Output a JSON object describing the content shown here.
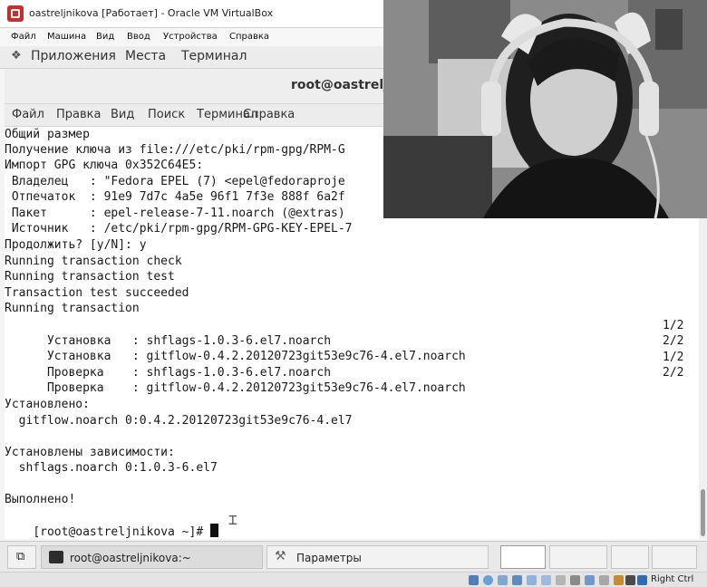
{
  "vbox": {
    "title": "oastreljnikova [Работает] - Oracle VM VirtualBox",
    "menu": [
      "Файл",
      "Машина",
      "Вид",
      "Ввод",
      "Устройства",
      "Справка"
    ]
  },
  "gnome": {
    "apps": "Приложения",
    "places": "Места",
    "terminal": "Терминал"
  },
  "terminal_window": {
    "title": "root@oastreljni",
    "menu": [
      "Файл",
      "Правка",
      "Вид",
      "Поиск",
      "Терминал",
      "Справка"
    ]
  },
  "output": {
    "lines": [
      "Общий размер",
      "Получение ключа из file:///etc/pki/rpm-gpg/RPM-G",
      "Импорт GPG ключа 0x352C64E5:",
      " Владелец   : \"Fedora EPEL (7) <epel@fedoraproje",
      " Отпечаток  : 91e9 7d7c 4a5e 96f1 7f3e 888f 6a2f",
      " Пакет      : epel-release-7-11.noarch (@extras)",
      " Источник   : /etc/pki/rpm-gpg/RPM-GPG-KEY-EPEL-7",
      "Продолжить? [y/N]: y",
      "Running transaction check",
      "Running transaction test",
      "Transaction test succeeded",
      "Running transaction"
    ],
    "transaction": [
      {
        "text": "  Установка   : shflags-1.0.3-6.el7.noarch",
        "count": "1/2"
      },
      {
        "text": "  Установка   : gitflow-0.4.2.20120723git53e9c76-4.el7.noarch",
        "count": "2/2"
      },
      {
        "text": "  Проверка    : shflags-1.0.3-6.el7.noarch",
        "count": "1/2"
      },
      {
        "text": "  Проверка    : gitflow-0.4.2.20120723git53e9c76-4.el7.noarch",
        "count": "2/2"
      }
    ],
    "installed_header": "Установлено:",
    "installed_pkg": "  gitflow.noarch 0:0.4.2.20120723git53e9c76-4.el7",
    "deps_header": "Установлены зависимости:",
    "deps_pkg": "  shflags.noarch 0:1.0.3-6.el7",
    "done": "Выполнено!",
    "prompt": "[root@oastreljnikova ~]# "
  },
  "taskbar": {
    "terminal_task": "root@oastreljnikova:~",
    "settings_task": "Параметры"
  },
  "statusbar": {
    "host_key": "Right Ctrl"
  }
}
